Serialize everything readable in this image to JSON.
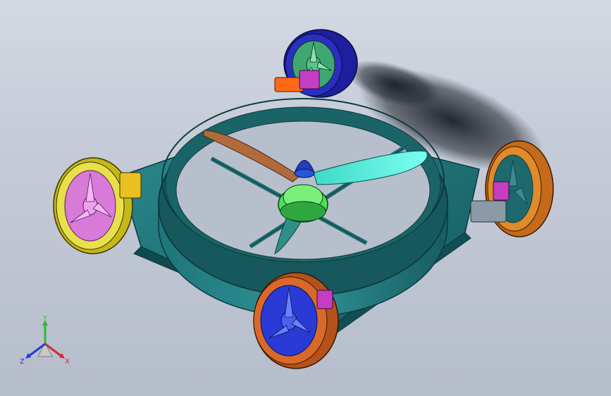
{
  "viewport": {
    "background_top": "#d3d8e2",
    "background_bottom": "#b6bdcb"
  },
  "model": {
    "frame_color": "#1e6e72",
    "frame_edge": "#0b3a3e",
    "wheel_colors": {
      "back": "#2a2fc0",
      "right": "#e08a2c",
      "left": "#e8e04a",
      "front": "#d9692a"
    },
    "propeller_colors": [
      "#b06a3c",
      "#4ff0d0"
    ],
    "spinner_color": "#1f3fbf",
    "motor_color": "#4ee05c"
  },
  "triad": {
    "y_label": "Y",
    "x_label": "X",
    "z_label": "Z",
    "y_color": "#2fb82f",
    "x_color": "#d42a2a",
    "z_color": "#2a3ad4"
  }
}
